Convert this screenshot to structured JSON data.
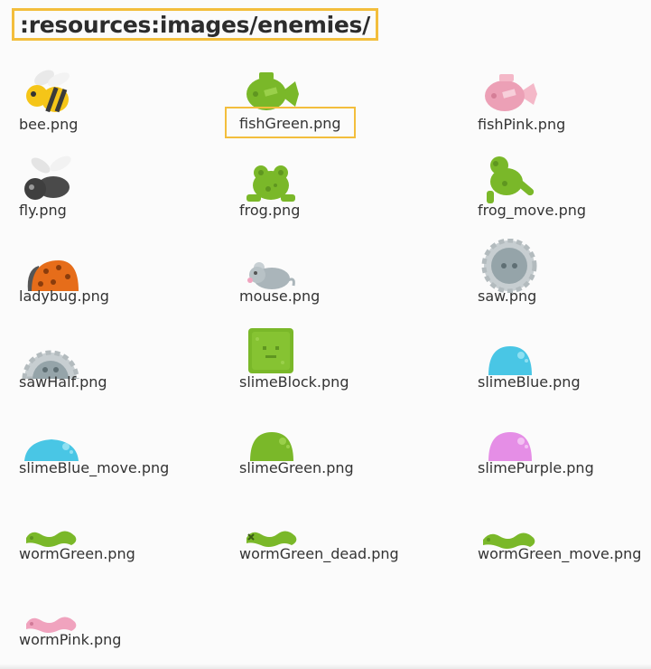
{
  "path": ":resources:images/enemies/",
  "files": [
    {
      "name": "bee.png",
      "icon": "bee-icon"
    },
    {
      "name": "fishGreen.png",
      "icon": "fish-green-icon",
      "selected": true
    },
    {
      "name": "fishPink.png",
      "icon": "fish-pink-icon"
    },
    {
      "name": "fly.png",
      "icon": "fly-icon"
    },
    {
      "name": "frog.png",
      "icon": "frog-icon"
    },
    {
      "name": "frog_move.png",
      "icon": "frog-move-icon"
    },
    {
      "name": "ladybug.png",
      "icon": "ladybug-icon"
    },
    {
      "name": "mouse.png",
      "icon": "mouse-icon"
    },
    {
      "name": "saw.png",
      "icon": "saw-icon"
    },
    {
      "name": "sawHalf.png",
      "icon": "saw-half-icon"
    },
    {
      "name": "slimeBlock.png",
      "icon": "slime-block-icon"
    },
    {
      "name": "slimeBlue.png",
      "icon": "slime-blue-icon"
    },
    {
      "name": "slimeBlue_move.png",
      "icon": "slime-blue-move-icon"
    },
    {
      "name": "slimeGreen.png",
      "icon": "slime-green-icon"
    },
    {
      "name": "slimePurple.png",
      "icon": "slime-purple-icon"
    },
    {
      "name": "wormGreen.png",
      "icon": "worm-green-icon"
    },
    {
      "name": "wormGreen_dead.png",
      "icon": "worm-green-dead-icon"
    },
    {
      "name": "wormGreen_move.png",
      "icon": "worm-green-move-icon"
    },
    {
      "name": "wormPink.png",
      "icon": "worm-pink-icon"
    }
  ],
  "colors": {
    "highlight": "#f3be3c",
    "green": "#7ab829",
    "pink": "#f0a3be",
    "blue": "#49c6e5",
    "purple": "#e58ee6"
  }
}
